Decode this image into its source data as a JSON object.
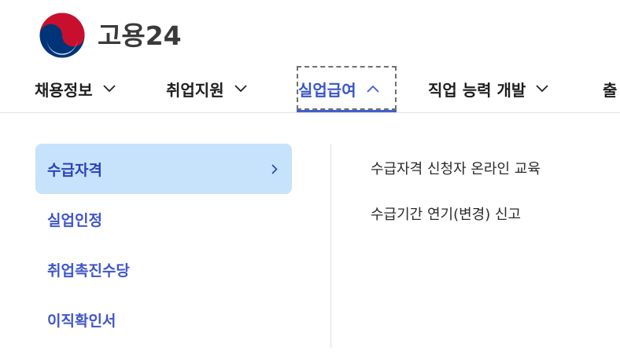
{
  "header": {
    "logo_text": "고용24"
  },
  "gnb": {
    "items": [
      {
        "label": "채용정보",
        "expanded": false
      },
      {
        "label": "취업지원",
        "expanded": false
      },
      {
        "label": "실업급여",
        "expanded": true
      },
      {
        "label": "직업 능력 개발",
        "expanded": false
      },
      {
        "label": "출"
      }
    ]
  },
  "submenu": {
    "items": [
      {
        "label": "수급자격",
        "selected": true
      },
      {
        "label": "실업인정"
      },
      {
        "label": "취업촉진수당"
      },
      {
        "label": "이직확인서"
      }
    ]
  },
  "detail": {
    "links": [
      {
        "label": "수급자격 신청자 온라인 교육"
      },
      {
        "label": "수급기간 연기(변경) 신고"
      }
    ]
  },
  "colors": {
    "accent": "#3f5fd0",
    "selected_bg": "#c7e2fb",
    "logo_red": "#c8102e",
    "logo_blue": "#003478"
  }
}
